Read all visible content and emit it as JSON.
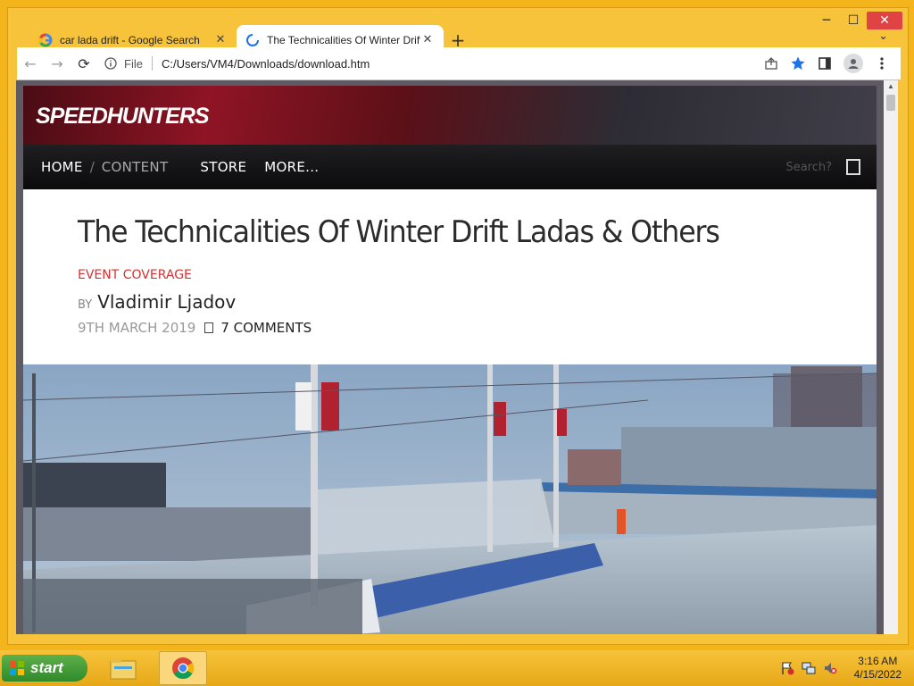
{
  "window": {
    "controls": {
      "minimize": "─",
      "maximize": "☐",
      "close": "✕"
    },
    "tab_search": "⌄"
  },
  "tabs": [
    {
      "title": "car lada drift - Google Search",
      "icon": "google-icon",
      "close": "✕"
    },
    {
      "title": "The Technicalities Of Winter Drift",
      "icon": "loading-spinner-icon",
      "close": "✕"
    }
  ],
  "new_tab": "+",
  "toolbar": {
    "back": "←",
    "forward": "→",
    "reload": "⟳",
    "scheme_label": "File",
    "url": "C:/Users/VM4/Downloads/download.htm"
  },
  "site": {
    "logo": "SPEEDHUNTERS",
    "nav": {
      "home": "HOME",
      "slash": "/",
      "content": "CONTENT",
      "store": "STORE",
      "more": "MORE...",
      "search_placeholder": "Search?"
    },
    "article": {
      "title": "The Technicalities Of Winter Drift Ladas & Others",
      "category": "EVENT COVERAGE",
      "by_label": "BY",
      "author": "Vladimir Ljadov",
      "date": "9TH MARCH 2019",
      "comments": "7 COMMENTS"
    }
  },
  "taskbar": {
    "start_label": "start",
    "clock_time": "3:16 AM",
    "clock_date": "4/15/2022"
  },
  "colors": {
    "window_frame": "#f6c33a",
    "category_red": "#d93030",
    "nav_background": "#111111",
    "taskbar_start": "#2f8a2a"
  }
}
